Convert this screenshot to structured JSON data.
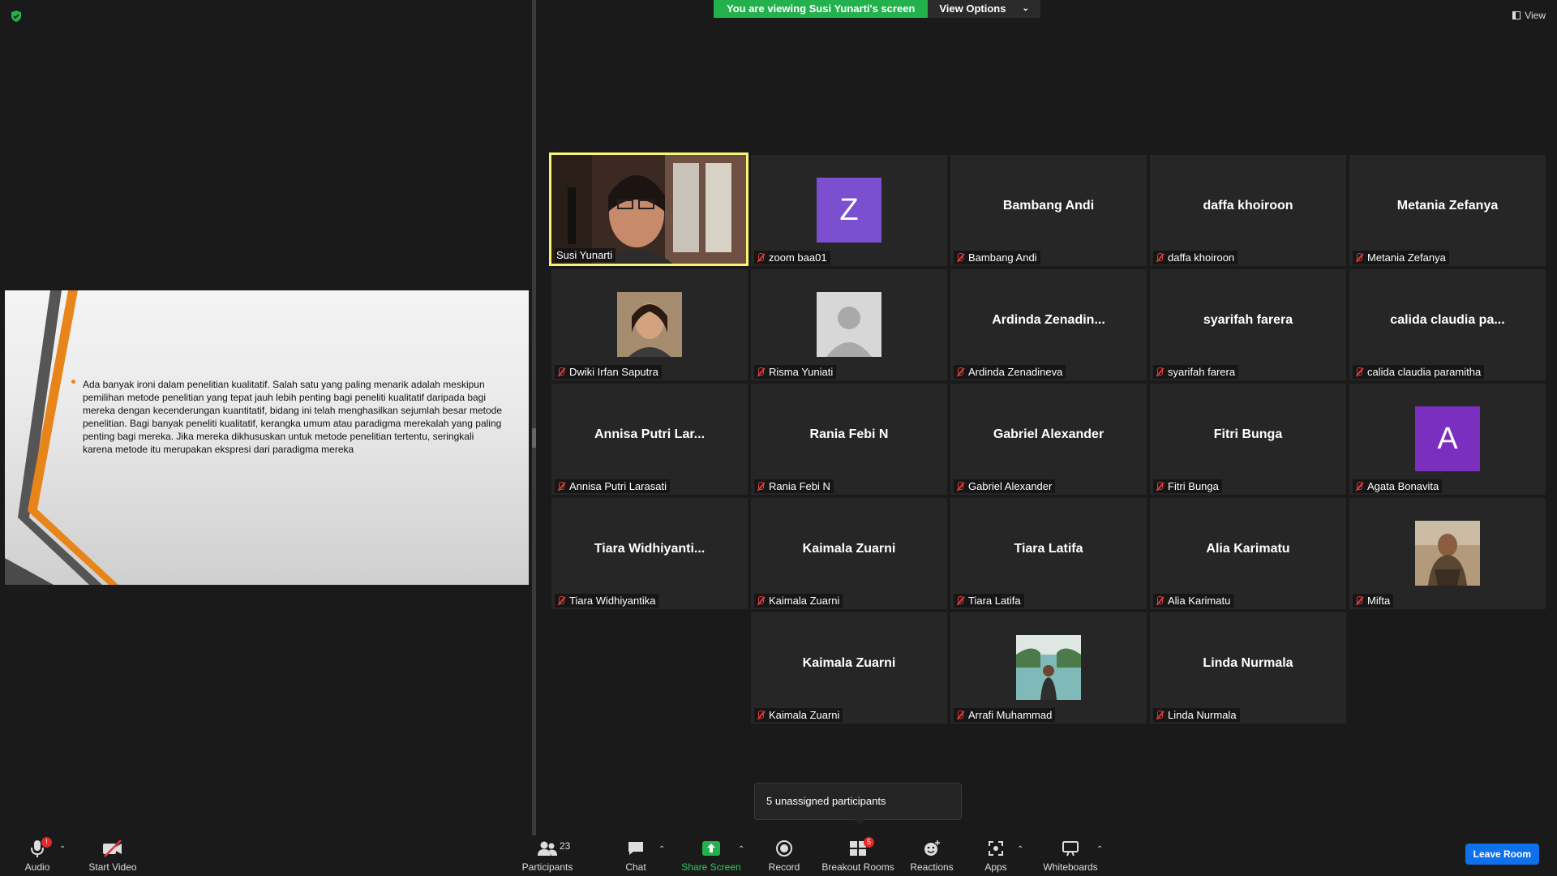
{
  "banner": {
    "viewing": "You are viewing Susi Yunarti's screen",
    "view_options": "View Options"
  },
  "view_label": "View",
  "slide": {
    "text": "Ada banyak ironi dalam penelitian kualitatif. Salah satu yang paling menarik adalah meskipun pemilihan metode penelitian yang tepat jauh lebih penting bagi peneliti kualitatif daripada bagi mereka dengan kecenderungan kuantitatif, bidang ini telah menghasilkan sejumlah besar metode penelitian. Bagi banyak peneliti kualitatif, kerangka umum atau paradigma merekalah yang paling penting bagi mereka. Jika mereka dikhususkan untuk metode penelitian tertentu, seringkali karena metode itu merupakan ekspresi dari paradigma mereka"
  },
  "participants": [
    {
      "big": "",
      "label": "Susi Yunarti"
    },
    {
      "big": "Z",
      "label": "zoom baa01"
    },
    {
      "big": "Bambang Andi",
      "label": "Bambang Andi"
    },
    {
      "big": "daffa khoiroon",
      "label": "daffa khoiroon"
    },
    {
      "big": "Metania Zefanya",
      "label": "Metania Zefanya"
    },
    {
      "big": "",
      "label": "Dwiki Irfan Saputra"
    },
    {
      "big": "",
      "label": "Risma Yuniati"
    },
    {
      "big": "Ardinda  Zenadin...",
      "label": "Ardinda Zenadineva"
    },
    {
      "big": "syarifah farera",
      "label": "syarifah farera"
    },
    {
      "big": "calida claudia pa...",
      "label": "calida claudia paramitha"
    },
    {
      "big": "Annisa Putri Lar...",
      "label": "Annisa Putri Larasati"
    },
    {
      "big": "Rania Febi N",
      "label": "Rania Febi N"
    },
    {
      "big": "Gabriel Alexander",
      "label": "Gabriel Alexander"
    },
    {
      "big": "Fitri Bunga",
      "label": "Fitri Bunga"
    },
    {
      "big": "A",
      "label": "Agata Bonavita"
    },
    {
      "big": "Tiara  Widhiyanti...",
      "label": "Tiara Widhiyantika"
    },
    {
      "big": "Kaimala Zuarni",
      "label": "Kaimala Zuarni"
    },
    {
      "big": "Tiara Latifa",
      "label": "Tiara Latifa"
    },
    {
      "big": "Alia Karimatu",
      "label": "Alia Karimatu"
    },
    {
      "big": "",
      "label": "Mifta"
    },
    {
      "big": "Kaimala Zuarni",
      "label": "Kaimala Zuarni"
    },
    {
      "big": "",
      "label": "Arrafi Muhammad"
    },
    {
      "big": "Linda Nurmala",
      "label": "Linda Nurmala"
    }
  ],
  "popup": "5 unassigned participants",
  "toolbar": {
    "audio": "Audio",
    "audio_badge": "!",
    "start_video": "Start Video",
    "participants": "Participants",
    "participants_count": "23",
    "chat": "Chat",
    "share_screen": "Share Screen",
    "record": "Record",
    "breakout_rooms": "Breakout Rooms",
    "breakout_badge": "5",
    "reactions": "Reactions",
    "apps": "Apps",
    "whiteboards": "Whiteboards",
    "leave": "Leave Room"
  },
  "colors": {
    "accent_green": "#23b14d",
    "active_speaker": "#f6f376",
    "leave_blue": "#0e71eb",
    "muted_red": "#e03a3a",
    "avatar_z": "#7b4fcf",
    "avatar_a": "#7a2fbf"
  },
  "icons": [
    "shield-icon",
    "grid-view-icon",
    "mic-off-icon",
    "microphone-icon",
    "video-off-icon",
    "participants-icon",
    "chat-icon",
    "share-screen-icon",
    "record-icon",
    "breakout-rooms-icon",
    "reactions-icon",
    "apps-icon",
    "whiteboard-icon"
  ]
}
